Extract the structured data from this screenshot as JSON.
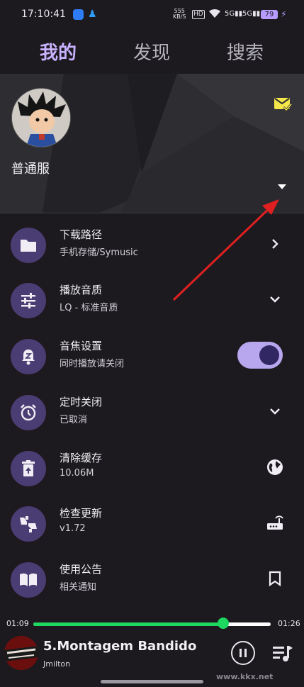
{
  "status_bar": {
    "time": "17:10:41",
    "net_speed_value": "555",
    "net_speed_unit": "KB/S",
    "hd_label": "HD",
    "signal1": "5G",
    "signal2": "5G",
    "battery": "79"
  },
  "tabs": [
    {
      "label": "我的",
      "active": true
    },
    {
      "label": "发现",
      "active": false
    },
    {
      "label": "搜索",
      "active": false
    }
  ],
  "profile": {
    "username": "普通服",
    "mail_icon": "mail-check-icon",
    "dropdown_icon": "caret-down-icon"
  },
  "settings": [
    {
      "title": "下载路径",
      "subtitle": "手机存储/Symusic",
      "icon": "folder-icon",
      "trailing": "chevron-right-icon"
    },
    {
      "title": "播放音质",
      "subtitle": "LQ - 标准音质",
      "icon": "tune-icon",
      "trailing": "chevron-down-icon"
    },
    {
      "title": "音焦设置",
      "subtitle": "同时播放请关闭",
      "icon": "bell-z-icon",
      "trailing": "toggle",
      "toggle_on": true
    },
    {
      "title": "定时关闭",
      "subtitle": "已取消",
      "icon": "alarm-icon",
      "trailing": "chevron-down-icon"
    },
    {
      "title": "清除缓存",
      "subtitle": "10.06M",
      "icon": "delete-icon",
      "trailing": "globe-icon"
    },
    {
      "title": "检查更新",
      "subtitle": "v1.72",
      "icon": "thumbs-icon",
      "trailing": "router-icon"
    },
    {
      "title": "使用公告",
      "subtitle": "相关通知",
      "icon": "book-icon",
      "trailing": "bookmark-icon"
    }
  ],
  "player": {
    "elapsed": "01:09",
    "duration": "01:26",
    "progress": 0.8,
    "song_title": "5.Montagem Bandido",
    "artist": "Jmilton"
  },
  "colors": {
    "background": "#1c1a1f",
    "accent": "#c9b3ff",
    "icon_circle": "#4a3d73",
    "progress": "#1ed760",
    "arrow": "#e02020",
    "mail": "#f5e64a"
  },
  "watermark": "www.kkx.net"
}
